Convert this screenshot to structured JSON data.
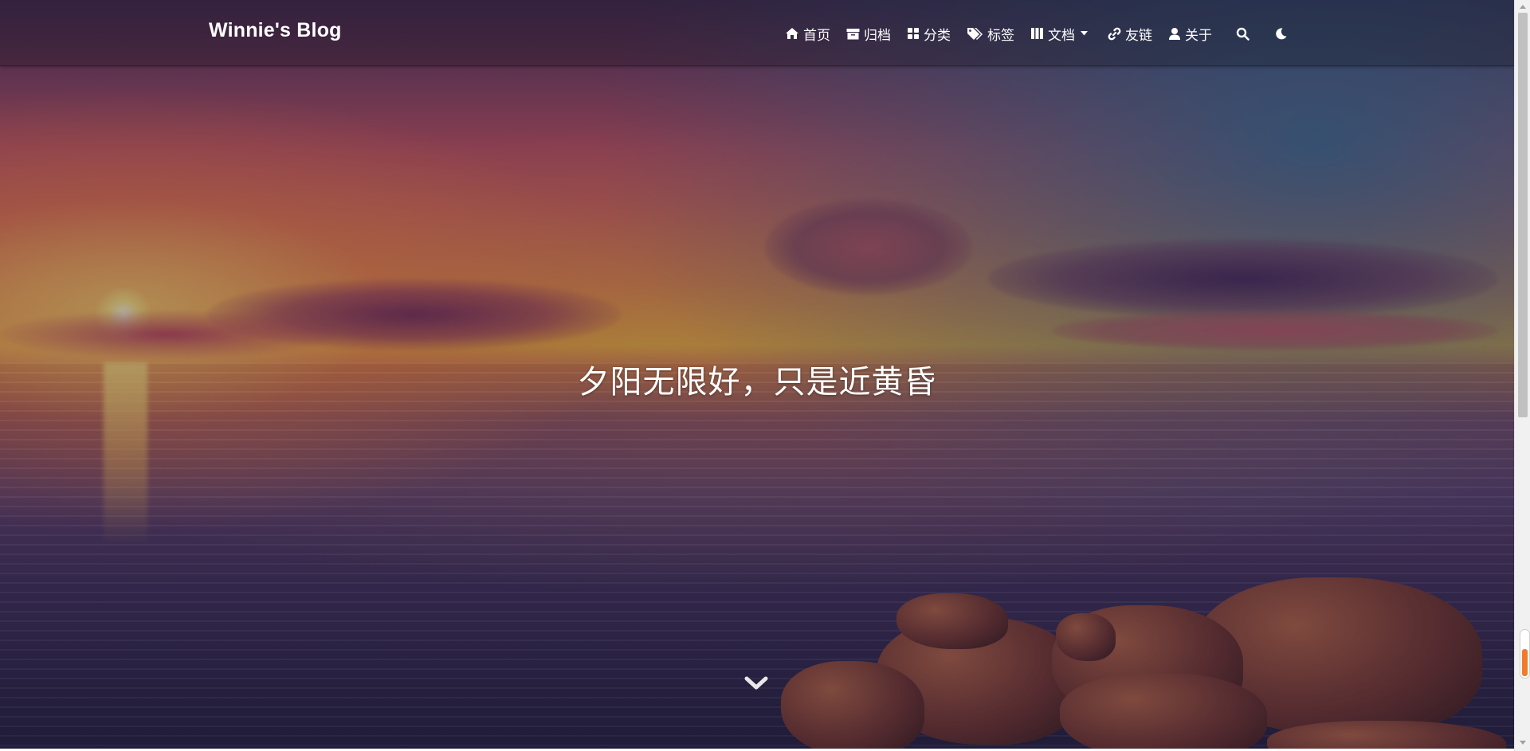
{
  "brand": {
    "title": "Winnie's Blog"
  },
  "nav": {
    "items": [
      {
        "label": "首页",
        "icon": "home-icon"
      },
      {
        "label": "归档",
        "icon": "archive-icon"
      },
      {
        "label": "分类",
        "icon": "category-icon"
      },
      {
        "label": "标签",
        "icon": "tags-icon"
      },
      {
        "label": "文档",
        "icon": "book-icon",
        "has_dropdown": true
      },
      {
        "label": "友链",
        "icon": "link-icon"
      },
      {
        "label": "关于",
        "icon": "user-icon"
      }
    ],
    "search_icon": "search-icon",
    "theme_icon": "moon-icon"
  },
  "banner": {
    "subtitle": "夕阳无限好，只是近黄昏",
    "scroll_icon": "chevron-down-icon"
  },
  "colors": {
    "nav_text": "#ffffff",
    "overlay": "rgba(0,0,0,0.30)",
    "scrollbar_track": "#f1f1f1",
    "scrollbar_thumb": "#c1c1c1",
    "side_widget_accent": "#f07b2a"
  }
}
